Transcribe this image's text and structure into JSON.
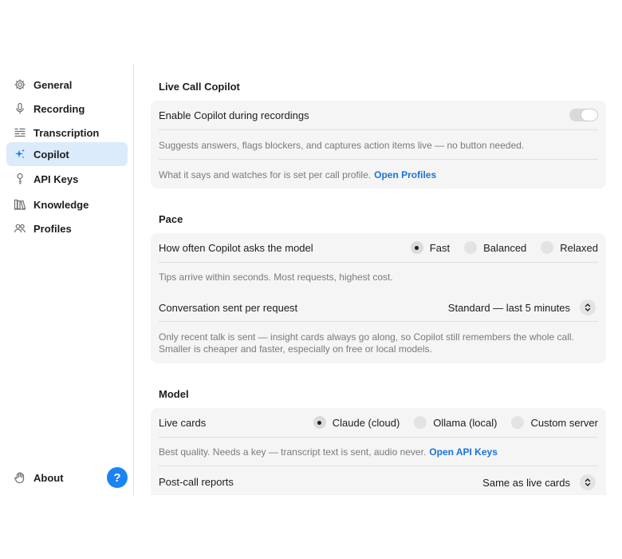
{
  "sidebar": {
    "items": [
      {
        "label": "General",
        "icon": "gear-icon"
      },
      {
        "label": "Recording",
        "icon": "microphone-icon"
      },
      {
        "label": "Transcription",
        "icon": "transcript-icon"
      },
      {
        "label": "Copilot",
        "icon": "sparkle-icon",
        "active": true
      },
      {
        "label": "API Keys",
        "icon": "key-icon"
      },
      {
        "label": "Knowledge",
        "icon": "books-icon"
      },
      {
        "label": "Profiles",
        "icon": "people-icon"
      }
    ],
    "about_label": "About",
    "help_label": "?"
  },
  "live": {
    "title": "Live Call Copilot",
    "enable_label": "Enable Copilot during recordings",
    "enable_on": false,
    "desc": "Suggests answers, flags blockers, and captures action items live — no button needed.",
    "profile_text": "What it says and watches for is set per call profile.",
    "profile_link": "Open Profiles"
  },
  "pace": {
    "title": "Pace",
    "frequency_label": "How often Copilot asks the model",
    "options": [
      "Fast",
      "Balanced",
      "Relaxed"
    ],
    "selected": "Fast",
    "frequency_desc": "Tips arrive within seconds. Most requests, highest cost.",
    "conversation_label": "Conversation sent per request",
    "conversation_value": "Standard — last 5 minutes",
    "conversation_desc": "Only recent talk is sent — insight cards always go along, so Copilot still remembers the whole call. Smaller is cheaper and faster, especially on free or local models."
  },
  "model": {
    "title": "Model",
    "live_cards_label": "Live cards",
    "options": [
      "Claude (cloud)",
      "Ollama (local)",
      "Custom server"
    ],
    "selected": "Claude (cloud)",
    "live_cards_desc": "Best quality. Needs a key — transcript text is sent, audio never.",
    "api_link": "Open API Keys",
    "post_call_label": "Post-call reports",
    "post_call_value": "Same as live cards"
  },
  "colors": {
    "accent": "#1a83f6",
    "link": "#1a73d9",
    "active_bg": "#dcebfb",
    "card_bg": "#f5f5f5"
  }
}
